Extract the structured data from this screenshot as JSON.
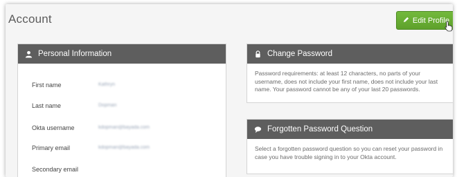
{
  "page": {
    "title": "Account"
  },
  "header": {
    "edit_profile_label": "Edit Profile",
    "edit_icon": "pencil-icon"
  },
  "colors": {
    "accent_green": "#66ab31",
    "panel_header": "#5e5e5e",
    "page_background": "#f5f5f5"
  },
  "personal_info": {
    "heading": "Personal Information",
    "icon": "user-icon",
    "fields": [
      {
        "label": "First name",
        "value": "Kathryn"
      },
      {
        "label": "Last name",
        "value": "Dopman"
      },
      {
        "label": "Okta username",
        "value": "kdopman@bayada.com"
      },
      {
        "label": "Primary email",
        "value": "kdopman@bayada.com"
      },
      {
        "label": "Secondary email",
        "value": ""
      }
    ]
  },
  "change_password": {
    "heading": "Change Password",
    "icon": "lock-icon",
    "text": "Password requirements: at least 12 characters, no parts of your username, does not include your first name, does not include your last name. Your password cannot be any of your last 20 passwords."
  },
  "forgotten_question": {
    "heading": "Forgotten Password Question",
    "icon": "speech-bubble-icon",
    "text": "Select a forgotten password question so you can reset your password in case you have trouble signing in to your Okta account."
  }
}
